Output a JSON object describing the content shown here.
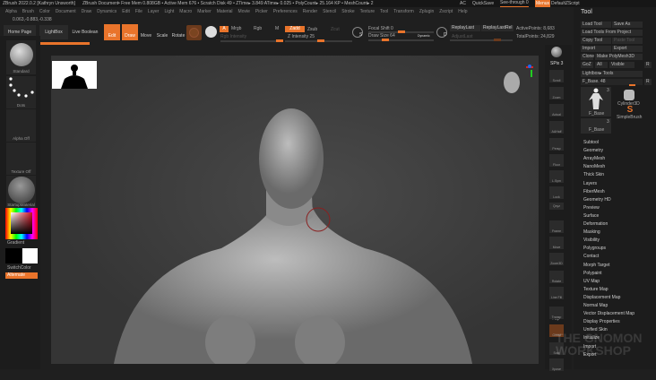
{
  "titlebar": {
    "app": "ZBrush 2022.0.2 [Kathryn Unsworth]",
    "doc": "ZBrush Document",
    "stats": "• Free Mem 0.808GB • Active Mem 676 • Scratch Disk 49 • ZTime▸ 3.849 ATime▸ 0.025 • PolyCount▸ 25.164 KP • MeshCount▸ 2",
    "ac": "AC",
    "quicksave": "QuickSave",
    "seethrough": "See-through 0",
    "menus": "Menus",
    "script": "DefaultZScript"
  },
  "menubar": [
    "Alpha",
    "Brush",
    "Color",
    "Document",
    "Draw",
    "Dynamics",
    "Edit",
    "File",
    "Layer",
    "Light",
    "Macro",
    "Marker",
    "Material",
    "Movie",
    "Picker",
    "Preferences",
    "Render",
    "Stencil",
    "Stroke",
    "Texture",
    "Tool",
    "Transform",
    "Zplugin",
    "Zscript",
    "Help"
  ],
  "coords": "0.063,-0.883,-0.338",
  "toolbar": {
    "home": "Home Page",
    "lightbox": "LightBox",
    "liveboolean": "Live Boolean",
    "edit": "Edit",
    "draw": "Draw",
    "move": "Move",
    "scale": "Scale",
    "rotate": "Rotate",
    "a": "A",
    "mrgb": "Mrgb",
    "rgb": "Rgb",
    "m": "M",
    "rgbint": "Rgb Intensity",
    "zadd": "Zadd",
    "zsub": "Zsub",
    "zcut": "Zcut",
    "zint": "Z Intensity 25",
    "focal": "Focal Shift 0",
    "drawsize": "Draw Size 64",
    "dynamic": "Dynamic",
    "replaylast": "ReplayLast",
    "replaylastrel": "ReplayLastRel",
    "adjustlast": "AdjustLast",
    "active": "ActivePoints: 8,683",
    "total": "TotalPoints: 24,829",
    "s": "S",
    "d": "D"
  },
  "left": {
    "brush": "Standard",
    "stroke": "Dots",
    "alpha": "Alpha Off",
    "texture": "Texture Off",
    "material": "StartupMaterial",
    "gradient": "Gradient",
    "switch": "SwitchColor",
    "alternate": "Alternate"
  },
  "shelf": [
    "Scroll",
    "Zoom",
    "Actual",
    "AAHalf",
    "Persp",
    "Floor",
    "L.Sym",
    "Lock",
    "Qxyz",
    "Frame",
    "Move",
    "Zoom3D",
    "Rotate",
    "Line Fill PolyF",
    "Transp",
    "Ghost",
    "Solo",
    "Xpose"
  ],
  "shelf_extra": {
    "spix": "SPix 3"
  },
  "tool": {
    "title": "Tool",
    "buttons": [
      "Load Tool",
      "Save As",
      "Load Tools From Project",
      "Copy Tool",
      "Paste Tool",
      "Import",
      "Export",
      "Clone",
      "Make PolyMesh3D",
      "GoZ",
      "All",
      "Visible",
      "R",
      "Lightbox▸ Tools"
    ],
    "fbase": "F_Base. 48",
    "r": "R",
    "thumbs": [
      "F_Base",
      "Cylinder3D",
      "SimpleBrush",
      "F_Base"
    ],
    "counts": [
      "3",
      "3"
    ],
    "sections": [
      "Subtool",
      "Geometry",
      "ArrayMesh",
      "NanoMesh",
      "Thick Skin",
      "Layers",
      "FiberMesh",
      "Geometry HD",
      "Preview",
      "Surface",
      "Deformation",
      "Masking",
      "Visibility",
      "Polygroups",
      "Contact",
      "Morph Target",
      "Polypaint",
      "UV Map",
      "Texture Map",
      "Displacement Map",
      "Normal Map",
      "Vector Displacement Map",
      "Display Properties",
      "Unified Skin",
      "Initialize",
      "Import",
      "Export"
    ]
  },
  "watermark": "THE GNOMON WORKSHOP",
  "colors": {
    "accent": "#e9742b"
  }
}
